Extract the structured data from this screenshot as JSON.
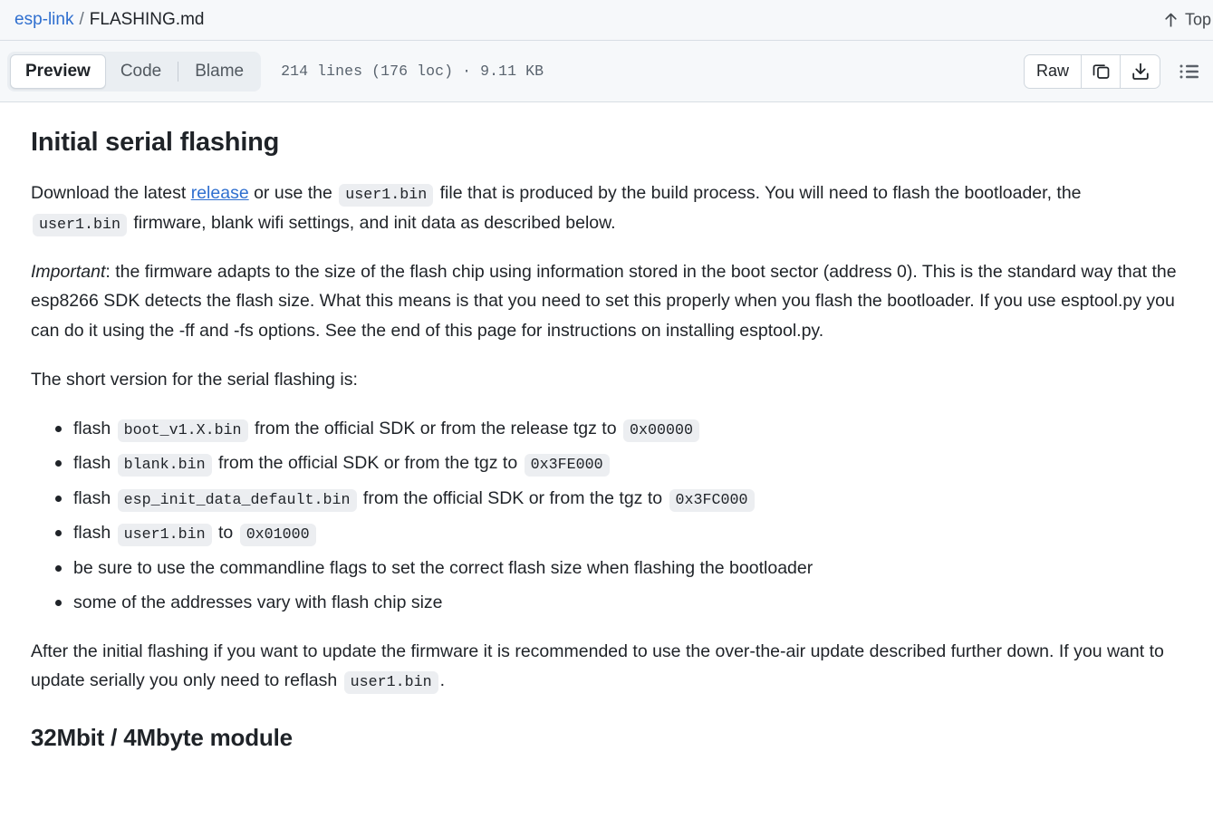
{
  "breadcrumb": {
    "repo": "esp-link",
    "separator": "/",
    "filename": "FLASHING.md"
  },
  "top_anchor": {
    "label": "Top",
    "icon": "arrow-up-icon"
  },
  "toolbar": {
    "tabs": [
      {
        "label": "Preview",
        "active": true
      },
      {
        "label": "Code",
        "active": false
      },
      {
        "label": "Blame",
        "active": false
      }
    ],
    "file_meta": "214 lines (176 loc) · 9.11 KB",
    "raw_label": "Raw",
    "copy_icon": "copy-icon",
    "download_icon": "download-icon",
    "outline_icon": "outline-list-icon"
  },
  "document": {
    "heading1": "Initial serial flashing",
    "para1": {
      "part1": "Download the latest ",
      "link": "release",
      "part2": " or use the ",
      "code1": "user1.bin",
      "part3": " file that is produced by the build process. You will need to flash the bootloader, the ",
      "code2": "user1.bin",
      "part4": " firmware, blank wifi settings, and init data as described below."
    },
    "para2": {
      "emphasis": "Important",
      "text": ": the firmware adapts to the size of the flash chip using information stored in the boot sector (address 0). This is the standard way that the esp8266 SDK detects the flash size. What this means is that you need to set this properly when you flash the bootloader. If you use esptool.py you can do it using the -ff and -fs options. See the end of this page for instructions on installing esptool.py."
    },
    "para3": "The short version for the serial flashing is:",
    "bullets": [
      {
        "pre": "flash ",
        "code1": "boot_v1.X.bin",
        "mid": " from the official SDK or from the release tgz to ",
        "code2": "0x00000",
        "post": ""
      },
      {
        "pre": "flash ",
        "code1": "blank.bin",
        "mid": " from the official SDK or from the tgz to ",
        "code2": "0x3FE000",
        "post": ""
      },
      {
        "pre": "flash ",
        "code1": "esp_init_data_default.bin",
        "mid": " from the official SDK or from the tgz to ",
        "code2": "0x3FC000",
        "post": ""
      },
      {
        "pre": "flash ",
        "code1": "user1.bin",
        "mid": " to ",
        "code2": "0x01000",
        "post": ""
      },
      {
        "pre": "be sure to use the commandline flags to set the correct flash size when flashing the bootloader",
        "code1": "",
        "mid": "",
        "code2": "",
        "post": ""
      },
      {
        "pre": "some of the addresses vary with flash chip size",
        "code1": "",
        "mid": "",
        "code2": "",
        "post": ""
      }
    ],
    "para4": {
      "part1": "After the initial flashing if you want to update the firmware it is recommended to use the over-the-air update described further down. If you want to update serially you only need to reflash ",
      "code": "user1.bin",
      "part2": "."
    },
    "heading2": "32Mbit / 4Mbyte module"
  },
  "colors": {
    "link": "#2f6fcf",
    "header_bg": "#f6f8fa",
    "border": "#d8dee4",
    "code_bg": "#eceef1",
    "text": "#1f2328",
    "muted": "#59636e"
  }
}
